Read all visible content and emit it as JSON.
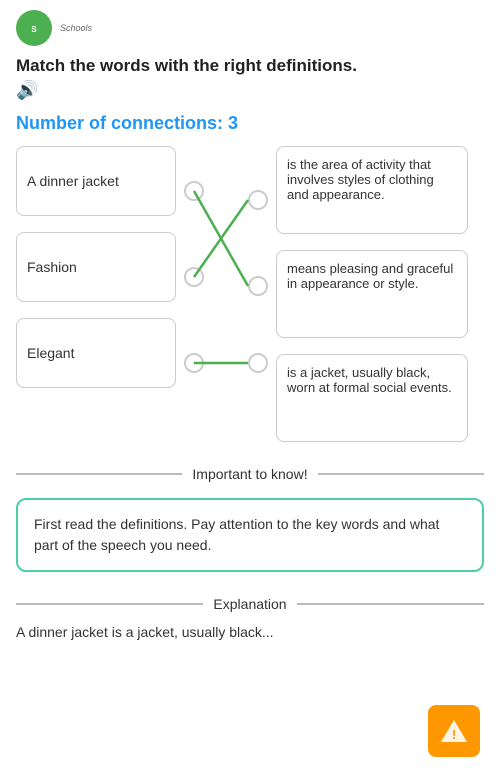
{
  "header": {
    "logo_alt": "Schools logo",
    "logo_label": "Schools"
  },
  "instructions": {
    "title": "Match the words with the right definitions.",
    "audio_icon": "🔊"
  },
  "connections": {
    "label": "Number of connections:",
    "count": "3"
  },
  "left_items": [
    {
      "id": "left-0",
      "text": "A dinner jacket"
    },
    {
      "id": "left-1",
      "text": "Fashion"
    },
    {
      "id": "left-2",
      "text": "Elegant"
    }
  ],
  "right_items": [
    {
      "id": "right-0",
      "text": "is the area of activity that involves styles of clothing and appearance."
    },
    {
      "id": "right-1",
      "text": "means pleasing and graceful in appearance or style."
    },
    {
      "id": "right-2",
      "text": "is a jacket, usually black, worn at formal social events."
    }
  ],
  "connections_data": [
    {
      "from": 0,
      "to": 1
    },
    {
      "from": 1,
      "to": 0
    },
    {
      "from": 2,
      "to": 2
    }
  ],
  "important": {
    "label": "Important to know!"
  },
  "tip": {
    "text": "First read the definitions. Pay attention to the key words and what part of the speech you need."
  },
  "explanation": {
    "label": "Explanation"
  },
  "explanation_content": {
    "text": "A dinner jacket is a jacket, usually black..."
  },
  "warning_button": {
    "label": "⚠"
  }
}
